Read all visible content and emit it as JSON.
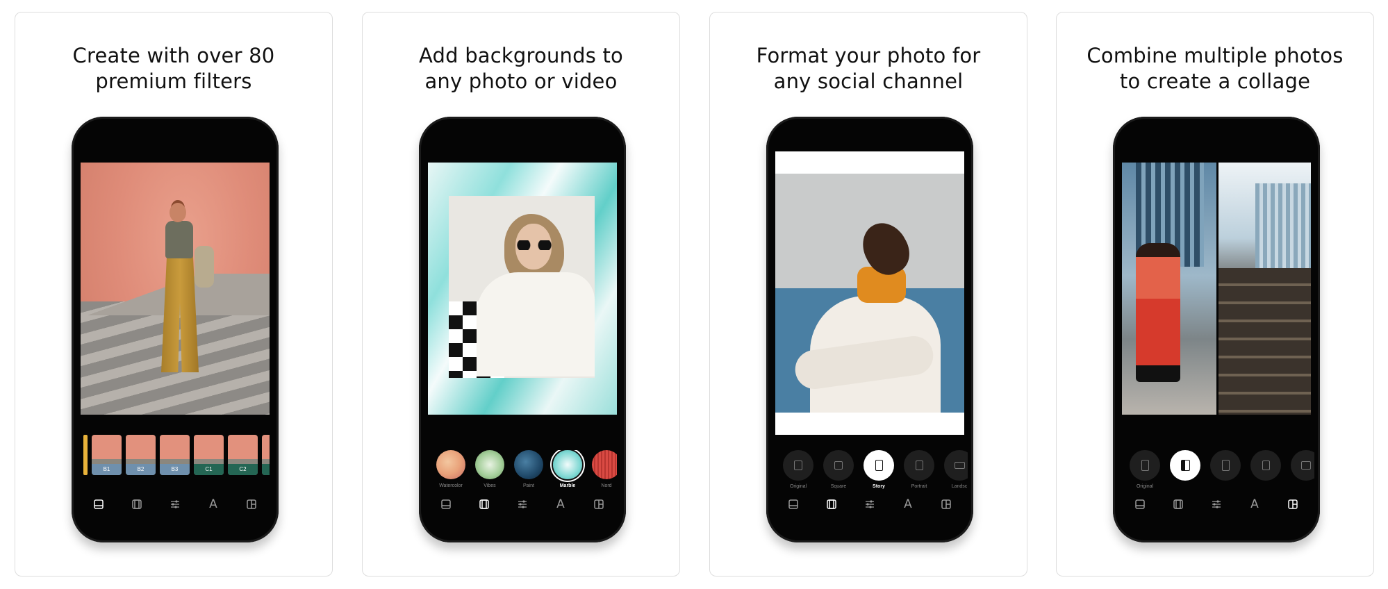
{
  "panels": [
    {
      "headline_1": "Create with over 80",
      "headline_2": "premium filters",
      "filters": [
        {
          "label": ""
        },
        {
          "label": "B1"
        },
        {
          "label": "B2"
        },
        {
          "label": "B3"
        },
        {
          "label": "C1"
        },
        {
          "label": "C2"
        }
      ]
    },
    {
      "headline_1": "Add backgrounds to",
      "headline_2": "any photo or video",
      "backgrounds": [
        {
          "label": "Watercolor",
          "color": "#e9a27a"
        },
        {
          "label": "Vibes",
          "color": "#a6cf9c"
        },
        {
          "label": "Paint",
          "color": "#1f4868"
        },
        {
          "label": "Marble",
          "color": "#7fd8d3",
          "selected": true
        },
        {
          "label": "Nord",
          "color": "#d94a43"
        }
      ]
    },
    {
      "headline_1": "Format your photo for",
      "headline_2": "any social channel",
      "formats": [
        {
          "label": "Original"
        },
        {
          "label": "Square"
        },
        {
          "label": "Story",
          "selected": true
        },
        {
          "label": "Portrait"
        },
        {
          "label": "Landsc"
        }
      ]
    },
    {
      "headline_1": "Combine multiple photos",
      "headline_2": "to create a collage",
      "layouts": [
        {
          "label": "Original"
        },
        {
          "label": "",
          "selected": true
        },
        {
          "label": ""
        },
        {
          "label": ""
        },
        {
          "label": ""
        }
      ]
    }
  ],
  "toolbar": {
    "tools": [
      "crop-icon",
      "background-icon",
      "adjust-icon",
      "text-icon",
      "collage-icon"
    ],
    "text_glyph": "A"
  },
  "colors": {
    "accent_selected": "#ffffff",
    "inactive_icon": "#9a9a9a",
    "phone_body": "#050505"
  }
}
